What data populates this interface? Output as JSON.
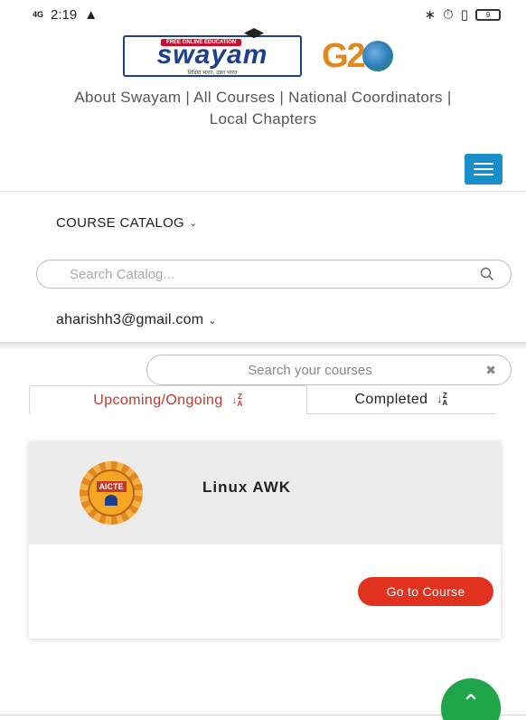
{
  "status_bar": {
    "signal": "4G",
    "time": "2:19",
    "battery": "9"
  },
  "header": {
    "swayam_banner": "FREE ONLINE EDUCATION",
    "swayam_word": "swayam",
    "swayam_sub": "शिक्षित भारत, उन्नत भारत",
    "g20_text": "G2",
    "links": [
      "About Swayam",
      "All Courses",
      "National Coordinators",
      "Local Chapters"
    ],
    "separator": "|"
  },
  "nav": {
    "catalog_label": "COURSE CATALOG",
    "search_catalog_placeholder": "Search Catalog...",
    "user_email": "aharishh3@gmail.com"
  },
  "courses": {
    "search_placeholder": "Search your courses",
    "tabs": [
      {
        "label": "Upcoming/Ongoing",
        "active": true
      },
      {
        "label": "Completed",
        "active": false
      }
    ],
    "sort_icon": "sort-alpha-icon",
    "items": [
      {
        "title": "Linux AWK",
        "provider_logo": "AICTE",
        "button_label": "Go to Course"
      }
    ]
  },
  "colors": {
    "accent_blue": "#1a8ec9",
    "active_tab_red": "#c0392b",
    "button_red": "#e0321f",
    "scroll_green": "#1fa54a"
  }
}
